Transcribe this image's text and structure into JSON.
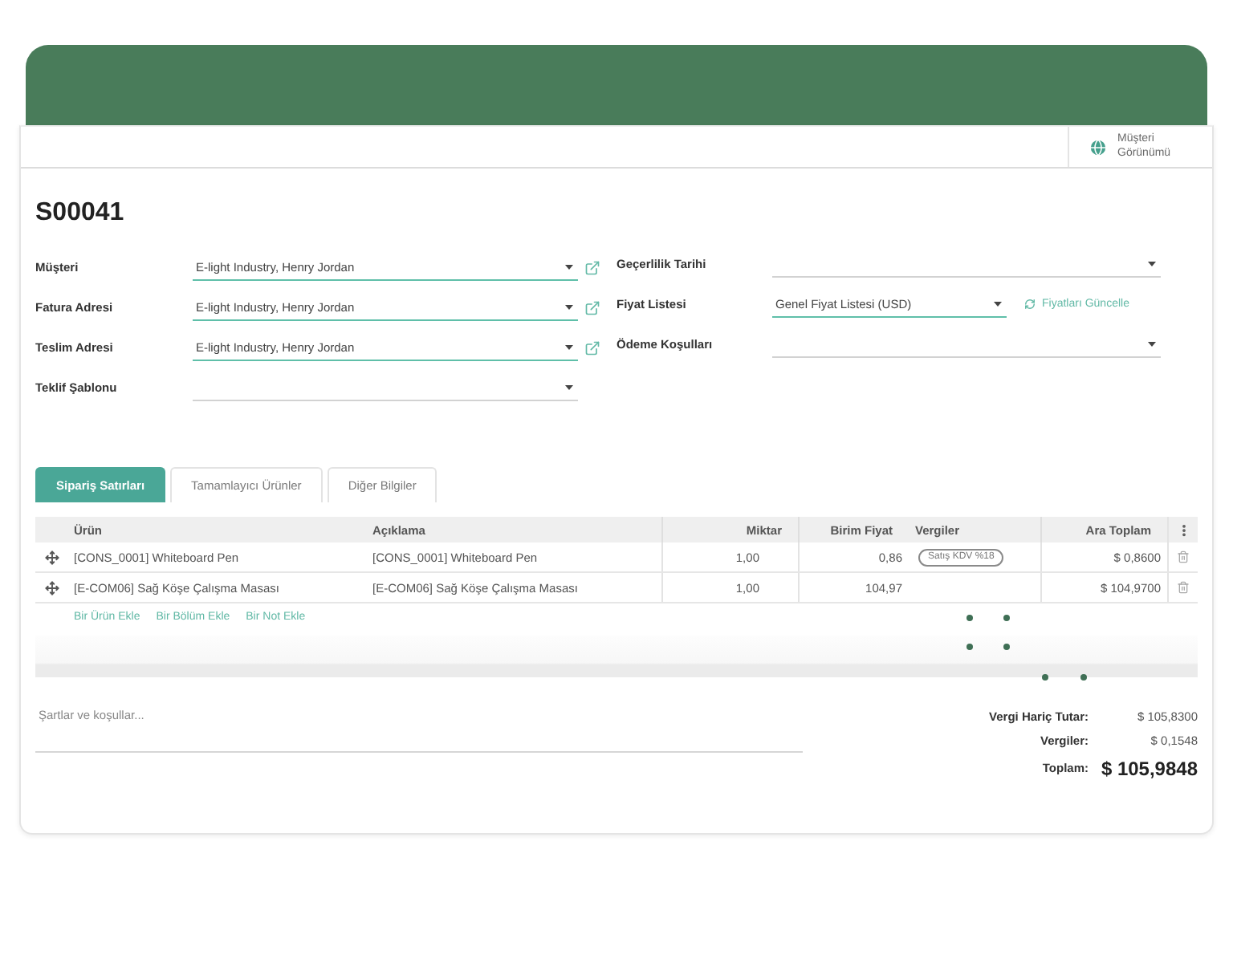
{
  "customer_view_button": {
    "label": "Müşteri Görünümü"
  },
  "title": "S00041",
  "left_fields": [
    {
      "label": "Müşteri",
      "value": "E-light Industry, Henry Jordan",
      "required": true,
      "external_link": true
    },
    {
      "label": "Fatura Adresi",
      "value": "E-light Industry, Henry Jordan",
      "required": true,
      "external_link": true
    },
    {
      "label": "Teslim Adresi",
      "value": "E-light Industry, Henry Jordan",
      "required": true,
      "external_link": true
    },
    {
      "label": "Teklif Şablonu",
      "required": false,
      "external_link": false
    }
  ],
  "right_fields": [
    {
      "label": "Geçerlilik Tarihi",
      "required": false
    },
    {
      "label": "Fiyat Listesi",
      "value": "Genel Fiyat Listesi (USD)",
      "required": true,
      "action": "Fiyatları Güncelle"
    },
    {
      "label": "Ödeme Koşulları",
      "required": false
    }
  ],
  "tabs": [
    {
      "label": "Sipariş Satırları",
      "selected": true
    },
    {
      "label": "Tamamlayıcı Ürünler",
      "selected": false
    },
    {
      "label": "Diğer Bilgiler",
      "selected": false
    }
  ],
  "table": {
    "columns": [
      "Ürün",
      "Açıklama",
      "Miktar",
      "Birim Fiyat",
      "Vergiler",
      "Ara Toplam"
    ],
    "rows": [
      {
        "product": "[CONS_0001] Whiteboard Pen",
        "description": "[CONS_0001] Whiteboard Pen",
        "quantity": "1,00",
        "unit_price": "0,86",
        "taxes": [
          "Satış KDV %18"
        ],
        "subtotal": "$ 0,8600"
      },
      {
        "product": "[E-COM06] Sağ Köşe Çalışma Masası",
        "description": "[E-COM06] Sağ Köşe Çalışma Masası",
        "quantity": "1,00",
        "unit_price": "104,97",
        "subtotal": "$ 104,9700"
      }
    ]
  },
  "add_links": [
    "Bir Ürün Ekle",
    "Bir Bölüm Ekle",
    "Bir Not Ekle"
  ],
  "terms": {
    "placeholder": "Şartlar ve koşullar..."
  },
  "totals": [
    {
      "kind": "line",
      "label": "Vergi Hariç Tutar:",
      "value": "$ 105,8300"
    },
    {
      "kind": "line",
      "label": "Vergiler:",
      "value": "$ 0,1548"
    },
    {
      "kind": "grand",
      "label": "Toplam:",
      "value": "$ 105,9848"
    }
  ]
}
